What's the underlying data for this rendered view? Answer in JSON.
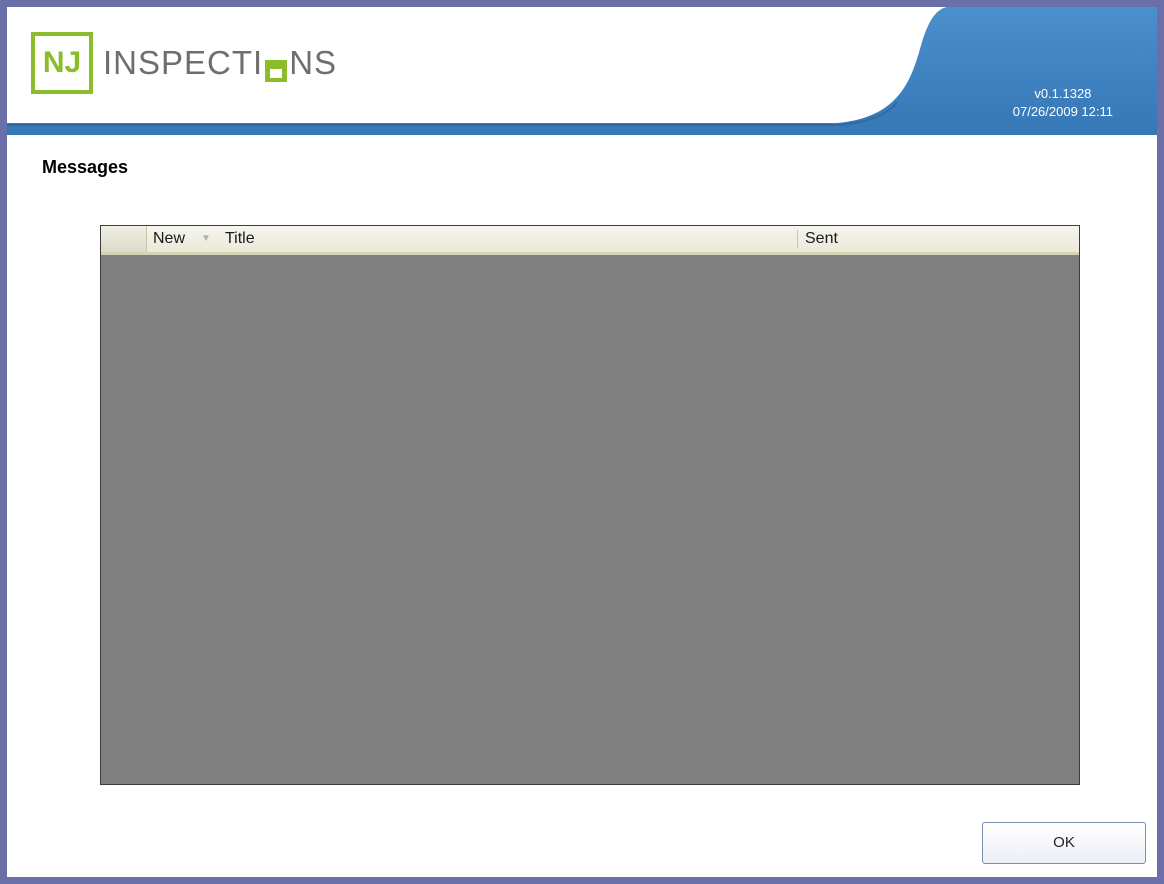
{
  "app": {
    "logo_initials": "NJ",
    "logo_text_left": "INSPECTI",
    "logo_text_right": "NS",
    "version": "v0.1.1328",
    "datetime": "07/26/2009 12:11"
  },
  "page": {
    "title": "Messages"
  },
  "messages_table": {
    "columns": {
      "new": "New",
      "title": "Title",
      "sent": "Sent"
    },
    "sort_indicator": "sort-down-icon",
    "rows": []
  },
  "buttons": {
    "ok": "OK"
  },
  "colors": {
    "brand_green": "#8bbd2a",
    "banner_blue": "#3e7fbd",
    "frame_border": "#6b6fa8",
    "grid_background": "#808080"
  }
}
